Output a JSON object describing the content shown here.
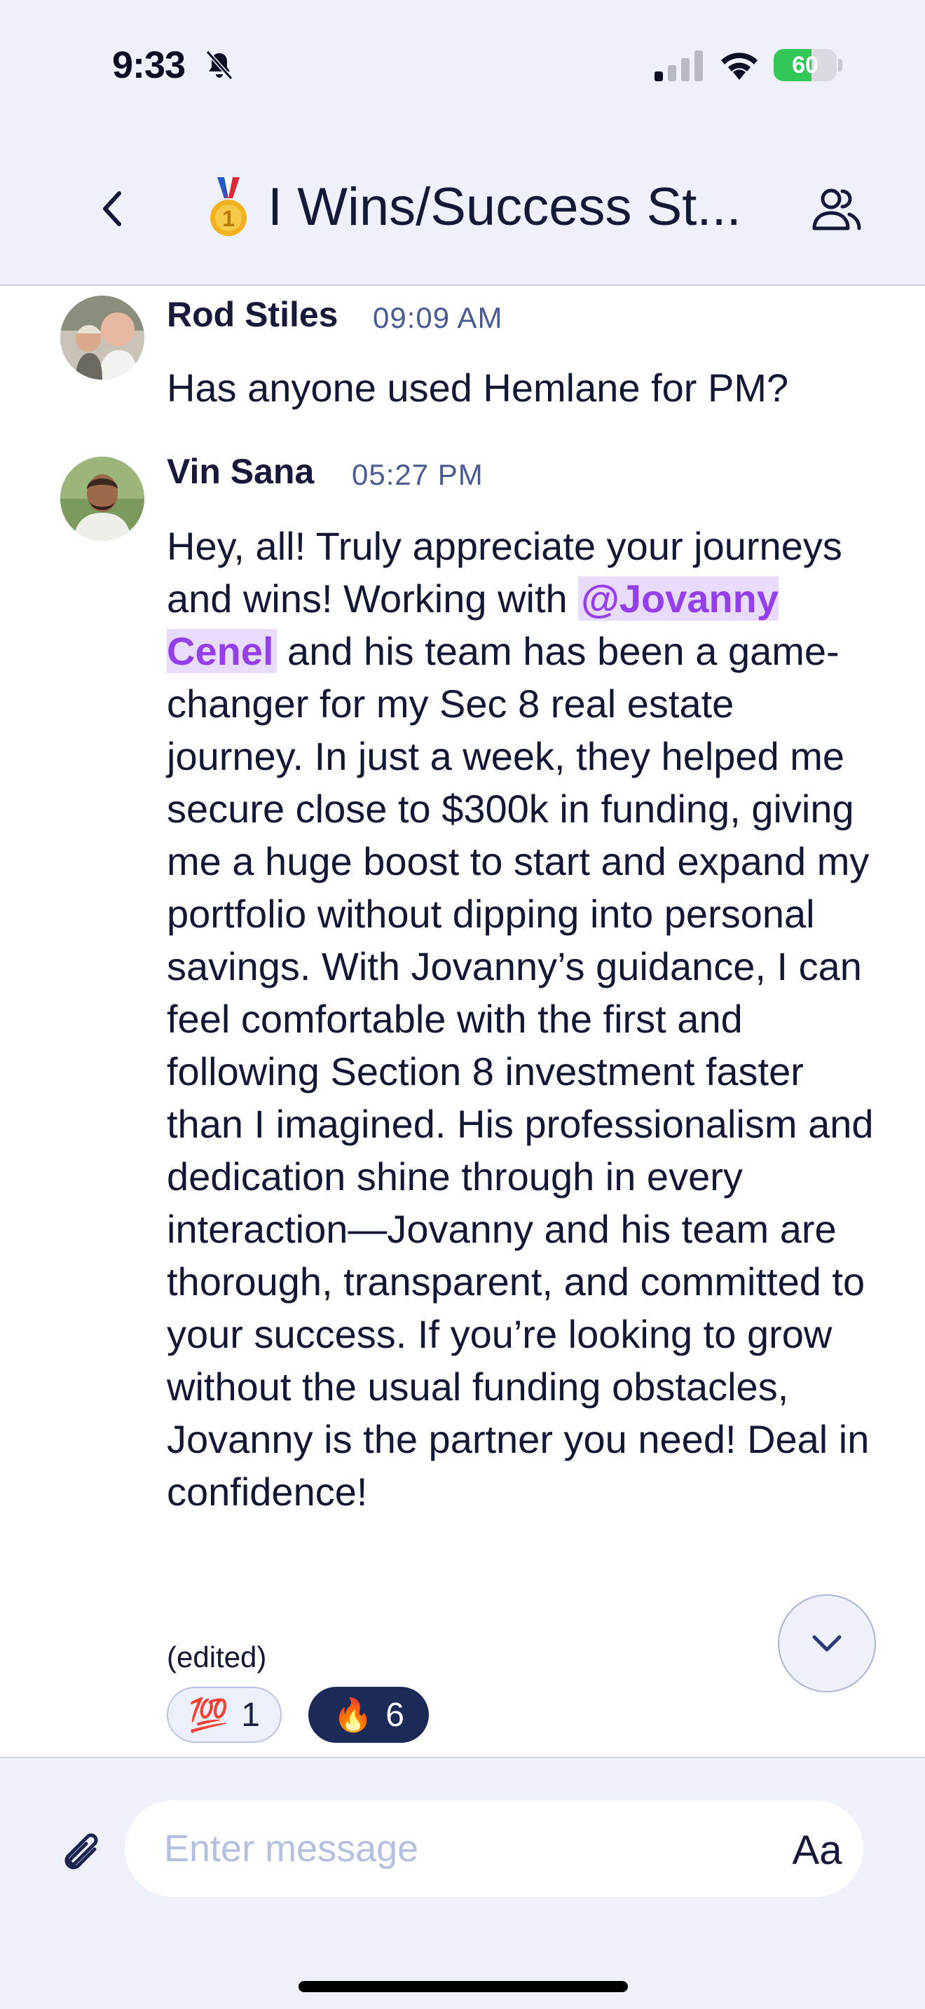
{
  "status_bar": {
    "time": "9:33",
    "battery": "60",
    "battery_level": 0.6
  },
  "header": {
    "channel_title": "I Wins/Success St...",
    "title_icon": "medal-icon",
    "back_icon": "chevron-left-icon",
    "members_icon": "members-icon"
  },
  "messages": [
    {
      "author": "Rod Stiles",
      "time": "09:09 AM",
      "body": "Has anyone used Hemlane for PM?"
    },
    {
      "author": "Vin Sana",
      "time": "05:27 PM",
      "body_before": "Hey, all! Truly appreciate your journeys and wins! Working with ",
      "mention": "@Jovanny Cenel",
      "body_after": " and his team has been a game-changer for my Sec 8 real estate journey. In just a week, they helped me secure close to $300k in funding, giving me a huge boost to start and expand my portfolio without dipping into personal savings. With Jovanny’s guidance, I can feel comfortable with the first and following Section 8 investment faster than I imagined. His professionalism and dedication shine through in every interaction—Jovanny and his team are thorough, transparent, and committed to your success. If you’re looking to grow without the usual funding obstacles, Jovanny is the partner you need! Deal in confidence!",
      "edited": "(edited)",
      "reactions": [
        {
          "emoji": "💯",
          "count": "1"
        },
        {
          "emoji": "🔥",
          "count": "6"
        }
      ]
    }
  ],
  "composer": {
    "placeholder": "Enter message",
    "format_label": "Aa",
    "attach_icon": "paperclip-icon"
  },
  "colors": {
    "header_bg": "#eef1f9",
    "mention_bg": "#e9dbfb",
    "mention_text": "#9340ec",
    "reaction_dark": "#1c2a57",
    "timestamp": "#4a5a92"
  }
}
